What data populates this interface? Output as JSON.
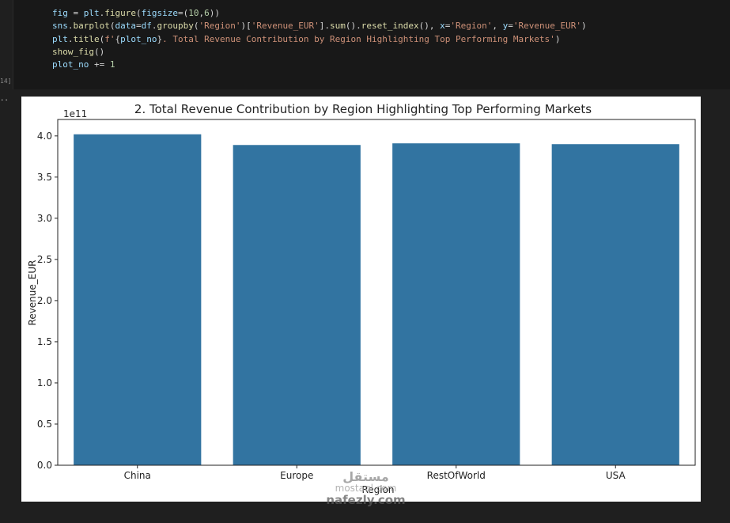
{
  "cell": {
    "exec_count": "14]",
    "output_marker": "..",
    "code_lines": [
      [
        [
          "tk-var",
          "fig"
        ],
        [
          "tk-op",
          " = "
        ],
        [
          "tk-var",
          "plt"
        ],
        [
          "tk-op",
          "."
        ],
        [
          "tk-fn",
          "figure"
        ],
        [
          "tk-op",
          "("
        ],
        [
          "tk-var",
          "figsize"
        ],
        [
          "tk-op",
          "=("
        ],
        [
          "tk-num",
          "10"
        ],
        [
          "tk-op",
          ","
        ],
        [
          "tk-num",
          "6"
        ],
        [
          "tk-op",
          "))"
        ]
      ],
      [
        [
          "tk-var",
          "sns"
        ],
        [
          "tk-op",
          "."
        ],
        [
          "tk-fn",
          "barplot"
        ],
        [
          "tk-op",
          "("
        ],
        [
          "tk-var",
          "data"
        ],
        [
          "tk-op",
          "="
        ],
        [
          "tk-var",
          "df"
        ],
        [
          "tk-op",
          "."
        ],
        [
          "tk-fn",
          "groupby"
        ],
        [
          "tk-op",
          "("
        ],
        [
          "tk-str",
          "'Region'"
        ],
        [
          "tk-op",
          ")["
        ],
        [
          "tk-str",
          "'Revenue_EUR'"
        ],
        [
          "tk-op",
          "]."
        ],
        [
          "tk-fn",
          "sum"
        ],
        [
          "tk-op",
          "()."
        ],
        [
          "tk-fn",
          "reset_index"
        ],
        [
          "tk-op",
          "(), "
        ],
        [
          "tk-var",
          "x"
        ],
        [
          "tk-op",
          "="
        ],
        [
          "tk-str",
          "'Region'"
        ],
        [
          "tk-op",
          ", "
        ],
        [
          "tk-var",
          "y"
        ],
        [
          "tk-op",
          "="
        ],
        [
          "tk-str",
          "'Revenue_EUR'"
        ],
        [
          "tk-op",
          ")"
        ]
      ],
      [
        [
          "tk-var",
          "plt"
        ],
        [
          "tk-op",
          "."
        ],
        [
          "tk-fn",
          "title"
        ],
        [
          "tk-op",
          "("
        ],
        [
          "tk-str",
          "f'"
        ],
        [
          "tk-op",
          "{"
        ],
        [
          "tk-var",
          "plot_no"
        ],
        [
          "tk-op",
          "}"
        ],
        [
          "tk-str",
          ". Total Revenue Contribution by Region Highlighting Top Performing Markets'"
        ],
        [
          "tk-op",
          ")"
        ]
      ],
      [
        [
          "tk-fn",
          "show_fig"
        ],
        [
          "tk-op",
          "()"
        ]
      ],
      [
        [
          "tk-var",
          "plot_no"
        ],
        [
          "tk-op",
          " += "
        ],
        [
          "tk-num",
          "1"
        ]
      ]
    ]
  },
  "chart_data": {
    "type": "bar",
    "title": "2. Total Revenue Contribution by Region Highlighting Top Performing Markets",
    "xlabel": "Region",
    "ylabel": "Revenue_EUR",
    "offset_label": "1e11",
    "categories": [
      "China",
      "Europe",
      "RestOfWorld",
      "USA"
    ],
    "values": [
      4.02,
      3.89,
      3.91,
      3.9
    ],
    "ylim": [
      0,
      4.2
    ],
    "yticks": [
      "0.0",
      "0.5",
      "1.0",
      "1.5",
      "2.0",
      "2.5",
      "3.0",
      "3.5",
      "4.0"
    ],
    "bar_color": "#3274a1",
    "grid": false
  },
  "watermark": {
    "top": "مستقل",
    "middle": "mostaql.com",
    "bottom": "nafezly.com"
  }
}
